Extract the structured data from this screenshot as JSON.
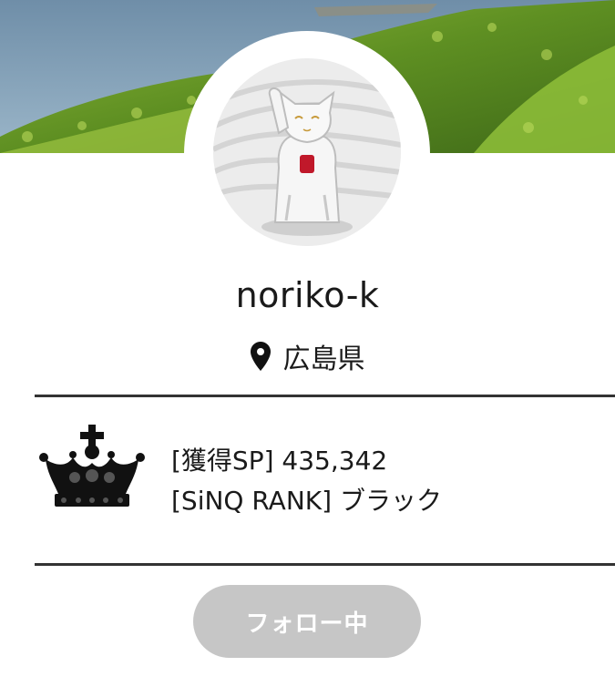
{
  "profile": {
    "username": "noriko-k",
    "location": "広島県"
  },
  "stats": {
    "points_label": "[獲得SP]",
    "points_value": "435,342",
    "rank_label": "[SiNQ RANK]",
    "rank_value": "ブラック"
  },
  "actions": {
    "follow_label": "フォロー中"
  },
  "icons": {
    "location": "map-pin-icon",
    "rank": "crown-icon"
  },
  "colors": {
    "divider": "#333333",
    "follow_button_bg": "#c6c6c6",
    "follow_button_text": "#ffffff"
  }
}
